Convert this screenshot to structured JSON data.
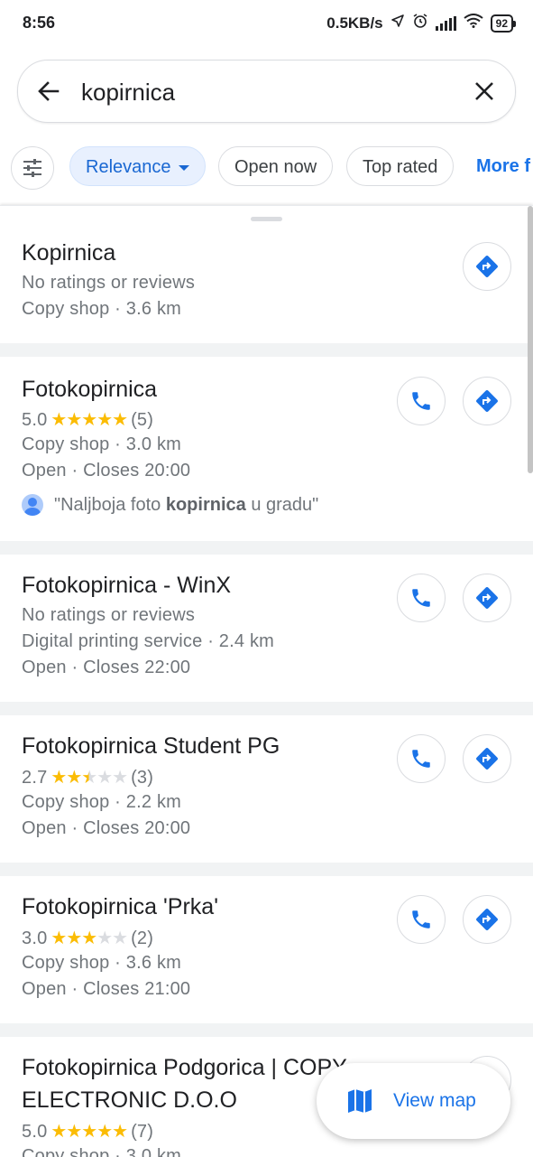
{
  "status_bar": {
    "time": "8:56",
    "network_speed": "0.5KB/s",
    "battery": "92"
  },
  "search": {
    "query": "kopirnica"
  },
  "filters": {
    "chips": [
      {
        "label": "Relevance",
        "active": true
      },
      {
        "label": "Open now",
        "active": false
      },
      {
        "label": "Top rated",
        "active": false
      }
    ],
    "more_label": "More f"
  },
  "results": [
    {
      "name": "Kopirnica",
      "rating_text": "No ratings or reviews",
      "category": "Copy shop · 3.6 km",
      "has_call": false
    },
    {
      "name": "Fotokopirnica",
      "rating": "5.0",
      "stars": 5,
      "reviews": "(5)",
      "category": "Copy shop · 3.0 km",
      "hours": "Open · Closes 20:00",
      "review_pre": "\"Naljboja foto ",
      "review_bold": "kopirnica",
      "review_post": " u gradu\"",
      "has_call": true
    },
    {
      "name": "Fotokopirnica - WinX",
      "rating_text": "No ratings or reviews",
      "category": "Digital printing service · 2.4 km",
      "hours": "Open · Closes 22:00",
      "has_call": true
    },
    {
      "name": "Fotokopirnica Student PG",
      "rating": "2.7",
      "stars": 2.5,
      "reviews": "(3)",
      "category": "Copy shop · 2.2 km",
      "hours": "Open · Closes 20:00",
      "has_call": true
    },
    {
      "name": "Fotokopirnica 'Prka'",
      "rating": "3.0",
      "stars": 3,
      "reviews": "(2)",
      "category": "Copy shop · 3.6 km",
      "hours": "Open · Closes 21:00",
      "has_call": true
    },
    {
      "name_line1": "Fotokopirnica Podgorica | COPY",
      "name_line2": "ELECTRONIC D.O.O",
      "rating": "5.0",
      "stars": 5,
      "reviews": "(7)",
      "category": "Copy shop · 3.0 km",
      "has_call": true
    }
  ],
  "view_map_label": "View map",
  "colors": {
    "accent": "#1a73e8",
    "star": "#fbbc04",
    "secondary_text": "#70757a"
  }
}
